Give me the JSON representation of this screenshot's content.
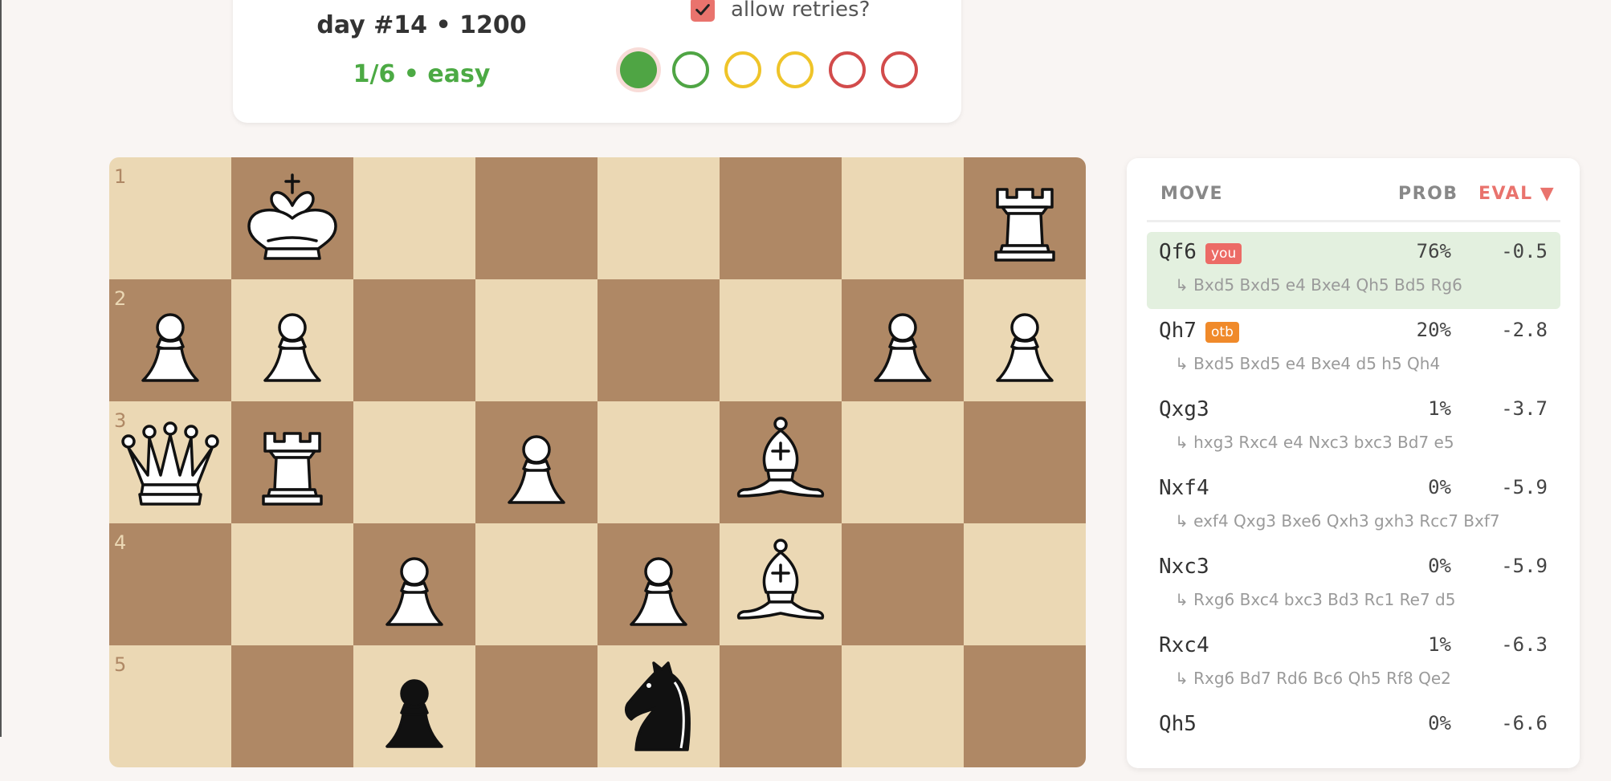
{
  "header": {
    "title": "day #14 • 1200",
    "subtitle": "1/6 • easy",
    "retry_label": "allow retries?",
    "retry_checked": true,
    "attempts": [
      {
        "state": "filled",
        "color": "#4fa544"
      },
      {
        "state": "open",
        "color": "#4fa544"
      },
      {
        "state": "open",
        "color": "#efc429"
      },
      {
        "state": "open",
        "color": "#efc429"
      },
      {
        "state": "open",
        "color": "#d24b4b"
      },
      {
        "state": "open",
        "color": "#d24b4b"
      }
    ]
  },
  "board": {
    "rank_labels": [
      "1",
      "2",
      "3",
      "4",
      "5"
    ],
    "rows": [
      [
        "",
        "white-king",
        "",
        "",
        "",
        "",
        "",
        "white-rook"
      ],
      [
        "white-pawn",
        "white-pawn",
        "",
        "",
        "",
        "",
        "white-pawn",
        "white-pawn"
      ],
      [
        "white-queen",
        "white-rook",
        "",
        "white-pawn",
        "",
        "white-bishop",
        "",
        ""
      ],
      [
        "",
        "",
        "white-pawn",
        "",
        "white-pawn",
        "white-bishop",
        "",
        ""
      ],
      [
        "",
        "",
        "black-pawn",
        "",
        "black-knight",
        "",
        "",
        ""
      ]
    ],
    "colors": {
      "light": "#ebd8b4",
      "dark": "#af8865"
    }
  },
  "moves_table": {
    "headers": {
      "move": "MOVE",
      "prob": "PROB",
      "eval": "EVAL ▼"
    },
    "rows": [
      {
        "move": "Qf6",
        "tag": "you",
        "prob": "76%",
        "eval": "-0.5",
        "line": "↳  Bxd5 Bxd5 e4 Bxe4 Qh5 Bd5 Rg6",
        "selected": true
      },
      {
        "move": "Qh7",
        "tag": "otb",
        "prob": "20%",
        "eval": "-2.8",
        "line": "↳  Bxd5 Bxd5 e4 Bxe4 d5 h5 Qh4"
      },
      {
        "move": "Qxg3",
        "tag": "",
        "prob": "1%",
        "eval": "-3.7",
        "line": "↳  hxg3 Rxc4 e4 Nxc3 bxc3 Bd7 e5"
      },
      {
        "move": "Nxf4",
        "tag": "",
        "prob": "0%",
        "eval": "-5.9",
        "line": "↳  exf4 Qxg3 Bxe6 Qxh3 gxh3 Rcc7 Bxf7"
      },
      {
        "move": "Nxc3",
        "tag": "",
        "prob": "0%",
        "eval": "-5.9",
        "line": "↳  Rxg6 Bxc4 bxc3 Bd3 Rc1 Re7 d5"
      },
      {
        "move": "Rxc4",
        "tag": "",
        "prob": "1%",
        "eval": "-6.3",
        "line": "↳  Rxg6 Bd7 Rd6 Bc6 Qh5 Rf8 Qe2"
      },
      {
        "move": "Qh5",
        "tag": "",
        "prob": "0%",
        "eval": "-6.6",
        "line": ""
      }
    ]
  }
}
